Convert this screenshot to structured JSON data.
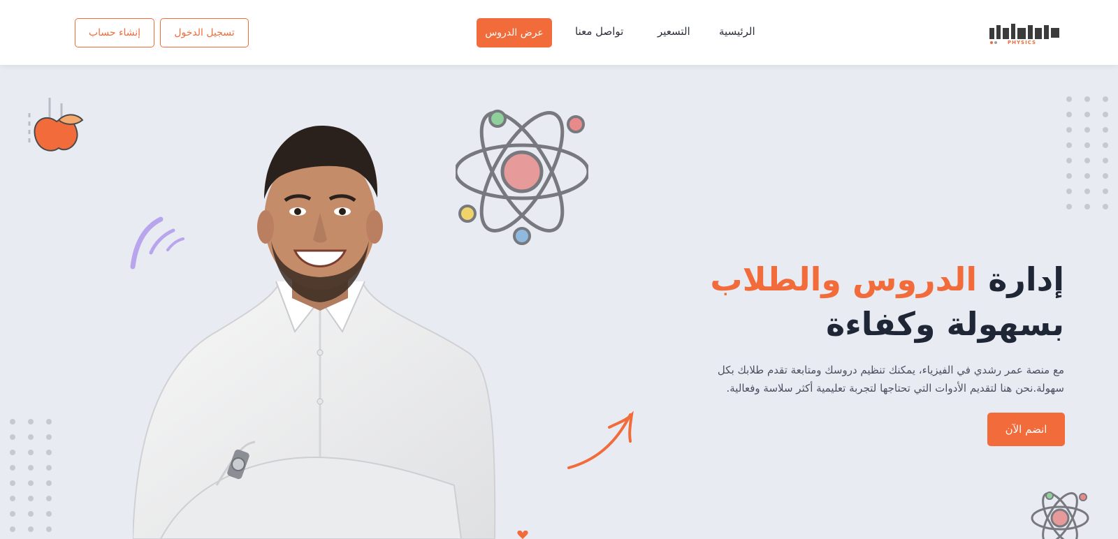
{
  "brand": {
    "logo_text": "عمر رشدي",
    "logo_sub": "PHYSICS"
  },
  "nav": {
    "home": "الرئيسية",
    "pricing": "التسعير",
    "contact": "تواصل معنا",
    "lessons_button": "عرض الدروس",
    "login_button": "تسجيل الدخول",
    "signup_button": "إنشاء حساب"
  },
  "hero": {
    "title_part1": "إدارة",
    "title_accent": "الدروس والطلاب",
    "title_part2": "بسهولة وكفاءة",
    "description": "مع منصة عمر رشدي في الفيزياء، يمكنك تنظيم دروسك ومتابعة تقدم طلابك بكل سهولة.نحن هنا لتقديم الأدوات التي تحتاجها لتجربة تعليمية أكثر سلاسة وفعالية.",
    "cta_button": "انضم الآن"
  },
  "colors": {
    "accent": "#f26b3a",
    "background": "#e8ebf2",
    "heading": "#1f2635",
    "navbar": "#ffffff"
  },
  "icons": [
    "atom-icon",
    "apple-icon",
    "arrow-icon",
    "dot-grid-icon",
    "spark-lines-icon"
  ]
}
